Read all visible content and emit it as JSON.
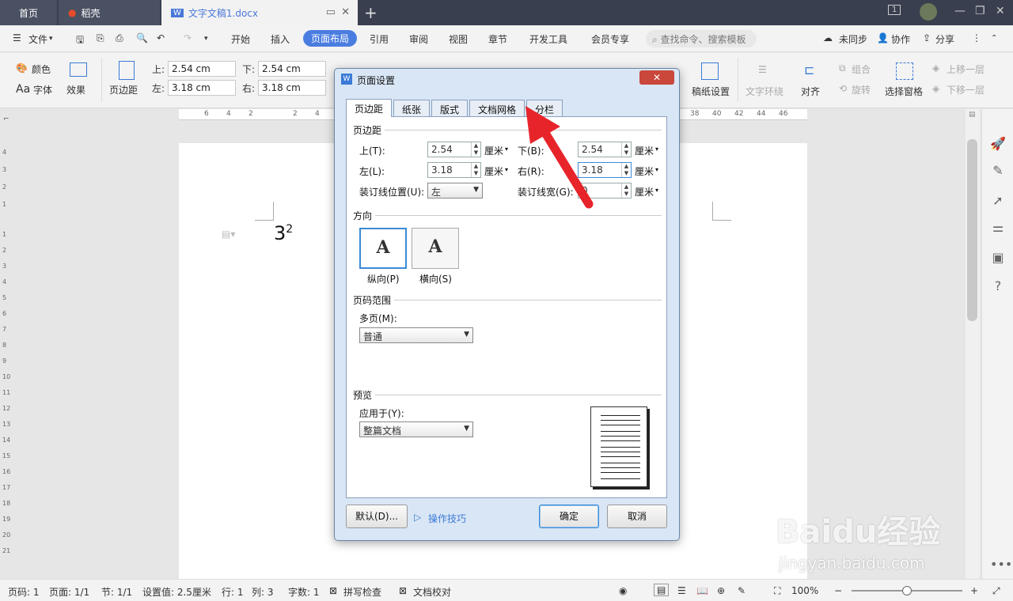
{
  "titlebar": {
    "tab_home": "首页",
    "tab_daoke": "稻壳",
    "tab_doc": "文字文稿1.docx",
    "badge": "1"
  },
  "menubar": {
    "file": "文件",
    "items": [
      "开始",
      "插入",
      "页面布局",
      "引用",
      "审阅",
      "视图",
      "章节",
      "开发工具",
      "会员专享"
    ],
    "active": "页面布局",
    "search_placeholder": "查找命令、搜索模板",
    "sync": "未同步",
    "collab": "协作",
    "share": "分享"
  },
  "ribbon": {
    "color": "颜色",
    "effect": "效果",
    "font": "字体",
    "margin": "页边距",
    "top_label": "上:",
    "bottom_label": "下:",
    "left_label": "左:",
    "right_label": "右:",
    "top": "2.54 cm",
    "bottom": "2.54 cm",
    "left": "3.18 cm",
    "right": "3.18 cm",
    "manuscript": "稿纸设置",
    "wrap": "文字环绕",
    "align": "对齐",
    "group": "组合",
    "rotate": "旋转",
    "select_pane": "选择窗格",
    "up_layer": "上移一层",
    "down_layer": "下移一层"
  },
  "hruler": [
    "6",
    "4",
    "2",
    "2",
    "4",
    "38",
    "40",
    "42",
    "44",
    "46"
  ],
  "vruler": [
    "4",
    "3",
    "2",
    "1",
    "1",
    "2",
    "3",
    "4",
    "5",
    "6",
    "7",
    "8",
    "9",
    "10",
    "11",
    "12",
    "13",
    "14",
    "15",
    "16",
    "17",
    "18",
    "19",
    "20",
    "21"
  ],
  "page": {
    "text": "3",
    "sup": "2"
  },
  "dialog": {
    "title": "页面设置",
    "close": "✕",
    "tabs": [
      "页边距",
      "纸张",
      "版式",
      "文档网格",
      "分栏"
    ],
    "margins_group": "页边距",
    "top_label": "上(T):",
    "top": "2.54",
    "bottom_label": "下(B):",
    "bottom": "2.54",
    "left_label": "左(L):",
    "left": "3.18",
    "right_label": "右(R):",
    "right": "3.18",
    "gutter_pos_label": "装订线位置(U):",
    "gutter_pos": "左",
    "gutter_label": "装订线宽(G):",
    "gutter": "0",
    "unit": "厘米",
    "orient_group": "方向",
    "portrait": "纵向(P)",
    "landscape": "横向(S)",
    "pages_group": "页码范围",
    "multi_label": "多页(M):",
    "multi": "普通",
    "preview_group": "预览",
    "apply_label": "应用于(Y):",
    "apply": "整篇文档",
    "default_btn": "默认(D)...",
    "tips": "操作技巧",
    "ok": "确定",
    "cancel": "取消"
  },
  "status": {
    "page": "页码: 1",
    "pages": "页面: 1/1",
    "section": "节: 1/1",
    "setting": "设置值: 2.5厘米",
    "row": "行: 1",
    "col": "列: 3",
    "words": "字数: 1",
    "spell": "拼写检查",
    "proof": "文档校对",
    "zoom": "100%"
  },
  "watermark": {
    "brand": "Baidu经验",
    "url": "jingyan.baidu.com"
  },
  "colors": {
    "accent": "#4a7de0",
    "title_bg": "#393f4f",
    "arrow": "#e8242b"
  }
}
